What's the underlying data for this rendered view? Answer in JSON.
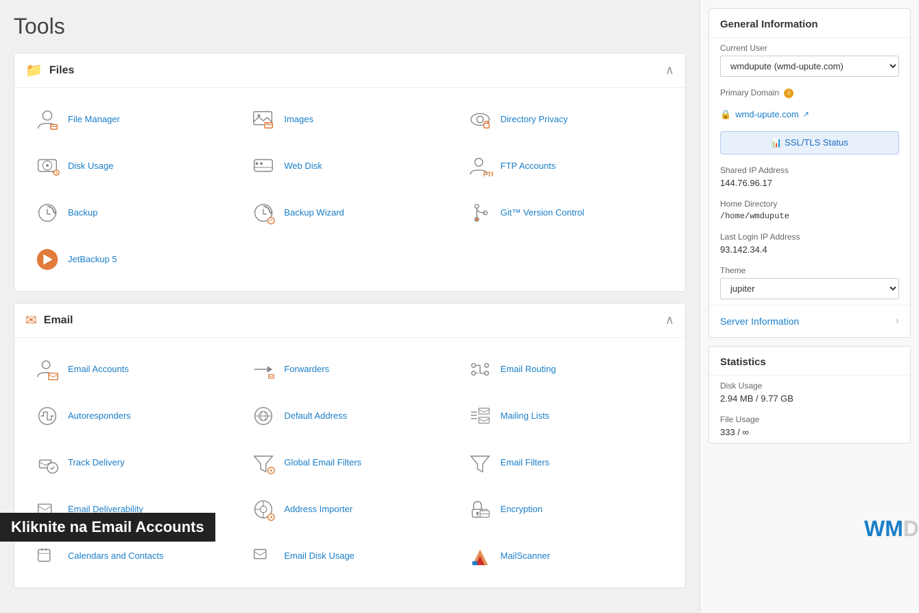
{
  "page": {
    "title": "Tools"
  },
  "files_section": {
    "title": "Files",
    "tools": [
      {
        "id": "file-manager",
        "label": "File Manager",
        "icon": "person-file"
      },
      {
        "id": "images",
        "label": "Images",
        "icon": "image"
      },
      {
        "id": "directory-privacy",
        "label": "Directory Privacy",
        "icon": "eye-lock"
      },
      {
        "id": "disk-usage",
        "label": "Disk Usage",
        "icon": "disk-clock"
      },
      {
        "id": "web-disk",
        "label": "Web Disk",
        "icon": "web-disk"
      },
      {
        "id": "ftp-accounts",
        "label": "FTP Accounts",
        "icon": "ftp"
      },
      {
        "id": "backup",
        "label": "Backup",
        "icon": "backup"
      },
      {
        "id": "backup-wizard",
        "label": "Backup Wizard",
        "icon": "backup-wizard"
      },
      {
        "id": "git-version-control",
        "label": "Git™ Version Control",
        "icon": "git"
      },
      {
        "id": "jetbackup5",
        "label": "JetBackup 5",
        "icon": "jetbackup"
      }
    ]
  },
  "email_section": {
    "title": "Email",
    "tools": [
      {
        "id": "email-accounts",
        "label": "Email Accounts",
        "icon": "email-accounts"
      },
      {
        "id": "forwarders",
        "label": "Forwarders",
        "icon": "forwarders"
      },
      {
        "id": "email-routing",
        "label": "Email Routing",
        "icon": "email-routing"
      },
      {
        "id": "autoresponders",
        "label": "Autoresponders",
        "icon": "autoresponders"
      },
      {
        "id": "default-address",
        "label": "Default Address",
        "icon": "default-address"
      },
      {
        "id": "mailing-lists",
        "label": "Mailing Lists",
        "icon": "mailing-lists"
      },
      {
        "id": "track-delivery",
        "label": "Track Delivery",
        "icon": "track-delivery"
      },
      {
        "id": "global-email-filters",
        "label": "Global Email Filters",
        "icon": "global-email-filters"
      },
      {
        "id": "email-filters",
        "label": "Email Filters",
        "icon": "email-filters"
      },
      {
        "id": "email-deliverability",
        "label": "Email Deliverability",
        "icon": "email-deliverability"
      },
      {
        "id": "address-importer",
        "label": "Address Importer",
        "icon": "address-importer"
      },
      {
        "id": "encryption",
        "label": "Encryption",
        "icon": "encryption"
      },
      {
        "id": "calendars-and-contacts",
        "label": "Calendars and Contacts",
        "icon": "calendars"
      },
      {
        "id": "email-disk-usage",
        "label": "Email Disk Usage",
        "icon": "email-disk-usage"
      },
      {
        "id": "mailscanner",
        "label": "MailScanner",
        "icon": "mailscanner"
      }
    ]
  },
  "sidebar": {
    "general_information": {
      "title": "General Information",
      "current_user_label": "Current User",
      "current_user_value": "wmdupute (wmd-upute.com)",
      "primary_domain_label": "Primary Domain",
      "primary_domain_value": "wmd-upute.com",
      "ssl_tls_button": "SSL/TLS Status",
      "shared_ip_label": "Shared IP Address",
      "shared_ip_value": "144.76.96.17",
      "home_dir_label": "Home Directory",
      "home_dir_value": "/home/wmdupute",
      "last_login_label": "Last Login IP Address",
      "last_login_value": "93.142.34.4",
      "theme_label": "Theme",
      "theme_value": "jupiter",
      "server_info_label": "Server Information"
    },
    "statistics": {
      "title": "Statistics",
      "disk_usage_label": "Disk Usage",
      "disk_usage_value": "2.94 MB / 9.77 GB",
      "file_usage_label": "File Usage",
      "file_usage_value": "333 / ∞"
    }
  },
  "bottom_banner": {
    "text": "Kliknite na Email Accounts"
  },
  "watermark": {
    "w": "W",
    "m": "M",
    "d": "D"
  }
}
